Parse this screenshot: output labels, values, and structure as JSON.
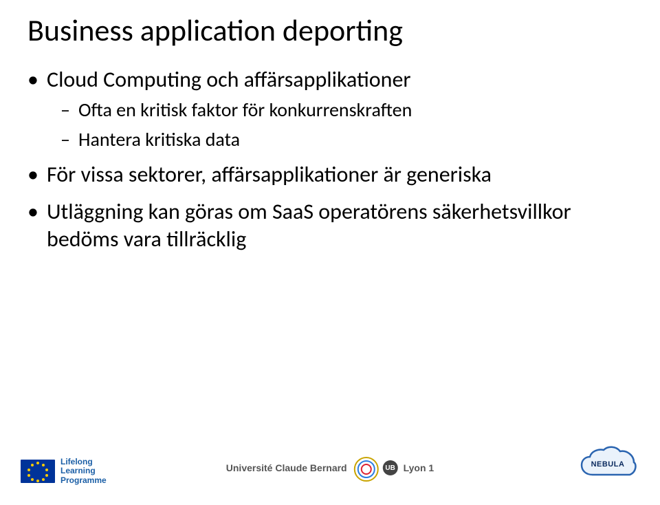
{
  "title": "Business application deporting",
  "bullets": {
    "b1": "Cloud Computing och affärsapplikationer",
    "b1_sub1": "Ofta en kritisk faktor för konkurrenskraften",
    "b1_sub2": "Hantera kritiska data",
    "b2": "För vissa sektorer, affärsapplikationer är generiska",
    "b3": "Utläggning kan göras om SaaS operatörens säkerhetsvillkor bedöms vara tillräcklig"
  },
  "footer": {
    "llp_line1": "Lifelong",
    "llp_line2": "Learning",
    "llp_line3": "Programme",
    "ucbl_left": "Université Claude Bernard",
    "ucbl_badge": "UB",
    "ucbl_right": "Lyon 1",
    "nebula": "NEBULA"
  }
}
